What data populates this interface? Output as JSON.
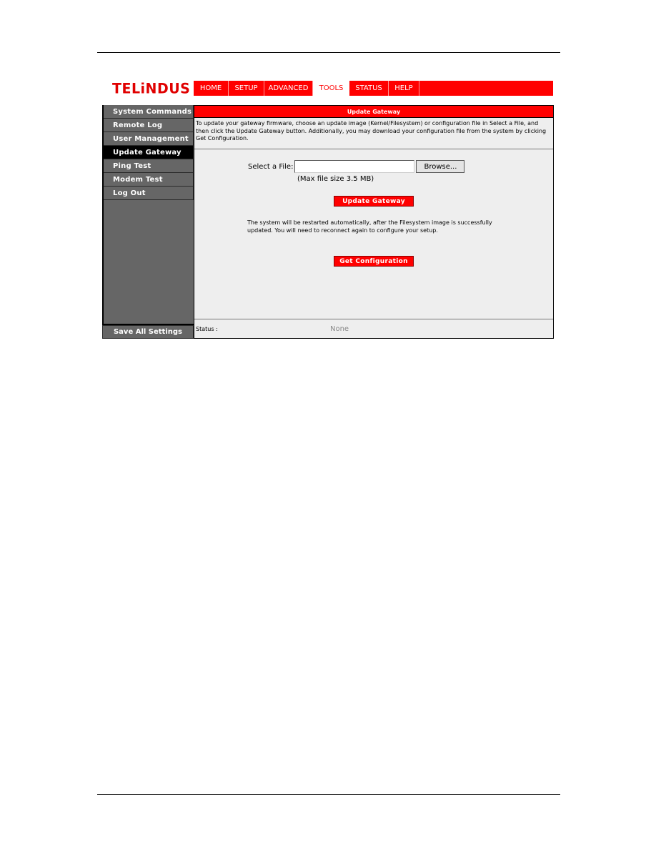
{
  "brand": {
    "logo_text": "TELiNDUS",
    "accent_color": "#ff0000"
  },
  "topnav": {
    "tabs": [
      {
        "label": "HOME",
        "active": false
      },
      {
        "label": "SETUP",
        "active": false
      },
      {
        "label": "ADVANCED",
        "active": false
      },
      {
        "label": "TOOLS",
        "active": true
      },
      {
        "label": "STATUS",
        "active": false
      },
      {
        "label": "HELP",
        "active": false
      }
    ]
  },
  "sidebar": {
    "items": [
      {
        "label": "System Commands",
        "active": false
      },
      {
        "label": "Remote Log",
        "active": false
      },
      {
        "label": "User Management",
        "active": false
      },
      {
        "label": "Update Gateway",
        "active": true
      },
      {
        "label": "Ping Test",
        "active": false
      },
      {
        "label": "Modem Test",
        "active": false
      },
      {
        "label": "Log Out",
        "active": false
      }
    ],
    "save_all_label": "Save All Settings"
  },
  "panel": {
    "title": "Update Gateway",
    "description": "To update your gateway firmware, choose an update image (Kernel/Filesystem) or configuration file in Select a File, and then click the Update Gateway button. Additionally, you may download your configuration file from the system by clicking Get Configuration.",
    "file_label": "Select a File:",
    "file_value": "",
    "browse_label": "Browse...",
    "max_size_note": "(Max file size 3.5 MB)",
    "update_button": "Update Gateway",
    "restart_note": "The system will be restarted automatically, after the Filesystem image is successfully updated. You will need to reconnect again to configure your setup.",
    "get_config_button": "Get Configuration",
    "status_label": "Status :",
    "status_value": "None"
  }
}
